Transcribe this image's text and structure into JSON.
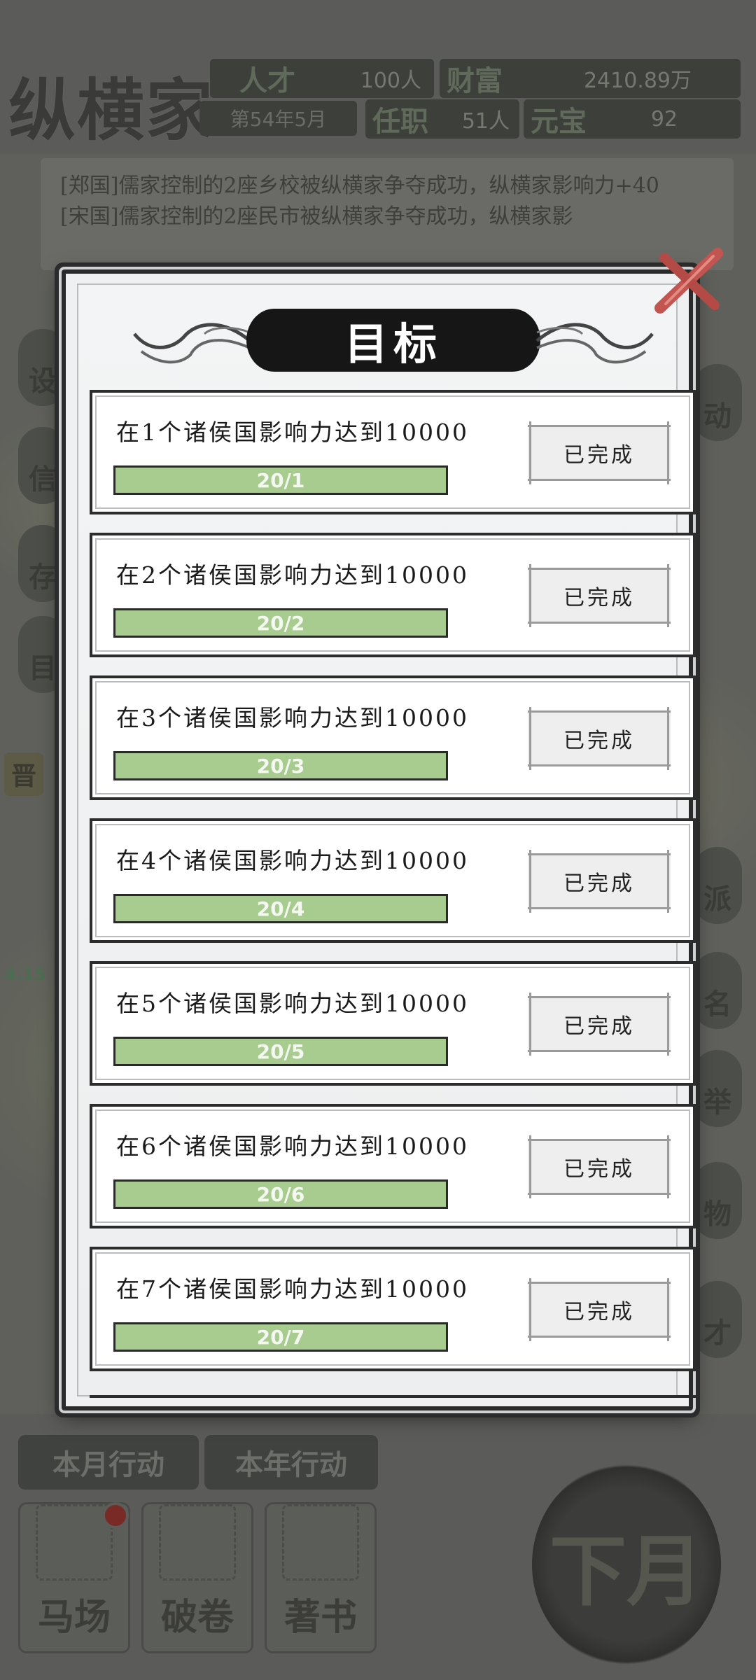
{
  "background": {
    "faction_name": "纵横家",
    "stats": {
      "talent_label": "人才",
      "talent_value": "100人",
      "wealth_label": "财富",
      "wealth_value": "2410.89万",
      "date": "第54年5月",
      "office_label": "任职",
      "office_value": "51人",
      "ingot_label": "元宝",
      "ingot_value": "92"
    },
    "news": [
      "[郑国]儒家控制的2座乡校被纵横家争夺成功，纵横家影响力+40",
      "[宋国]儒家控制的2座民市被纵横家争夺成功，纵横家影"
    ],
    "side_buttons_left": [
      "设",
      "信",
      "存",
      "目"
    ],
    "side_tag": "晋",
    "side_value": "4.15",
    "side_buttons_right": [
      "动",
      "派",
      "名",
      "举",
      "物",
      "才"
    ],
    "tabs": [
      "本月行动",
      "本年行动"
    ],
    "actions": [
      "马场",
      "破卷",
      "著书"
    ],
    "next_month": "下月"
  },
  "modal": {
    "title": "目标",
    "goals": [
      {
        "text": "在1个诸侯国影响力达到10000",
        "progress_label": "20/1",
        "progress": 1.0,
        "status": "已完成"
      },
      {
        "text": "在2个诸侯国影响力达到10000",
        "progress_label": "20/2",
        "progress": 1.0,
        "status": "已完成"
      },
      {
        "text": "在3个诸侯国影响力达到10000",
        "progress_label": "20/3",
        "progress": 1.0,
        "status": "已完成"
      },
      {
        "text": "在4个诸侯国影响力达到10000",
        "progress_label": "20/4",
        "progress": 1.0,
        "status": "已完成"
      },
      {
        "text": "在5个诸侯国影响力达到10000",
        "progress_label": "20/5",
        "progress": 1.0,
        "status": "已完成"
      },
      {
        "text": "在6个诸侯国影响力达到10000",
        "progress_label": "20/6",
        "progress": 1.0,
        "status": "已完成"
      },
      {
        "text": "在7个诸侯国影响力达到10000",
        "progress_label": "20/7",
        "progress": 1.0,
        "status": "已完成"
      }
    ]
  },
  "colors": {
    "progress_fill": "#a8cc90",
    "close_accent": "#c2554f",
    "banner": "#161616"
  }
}
